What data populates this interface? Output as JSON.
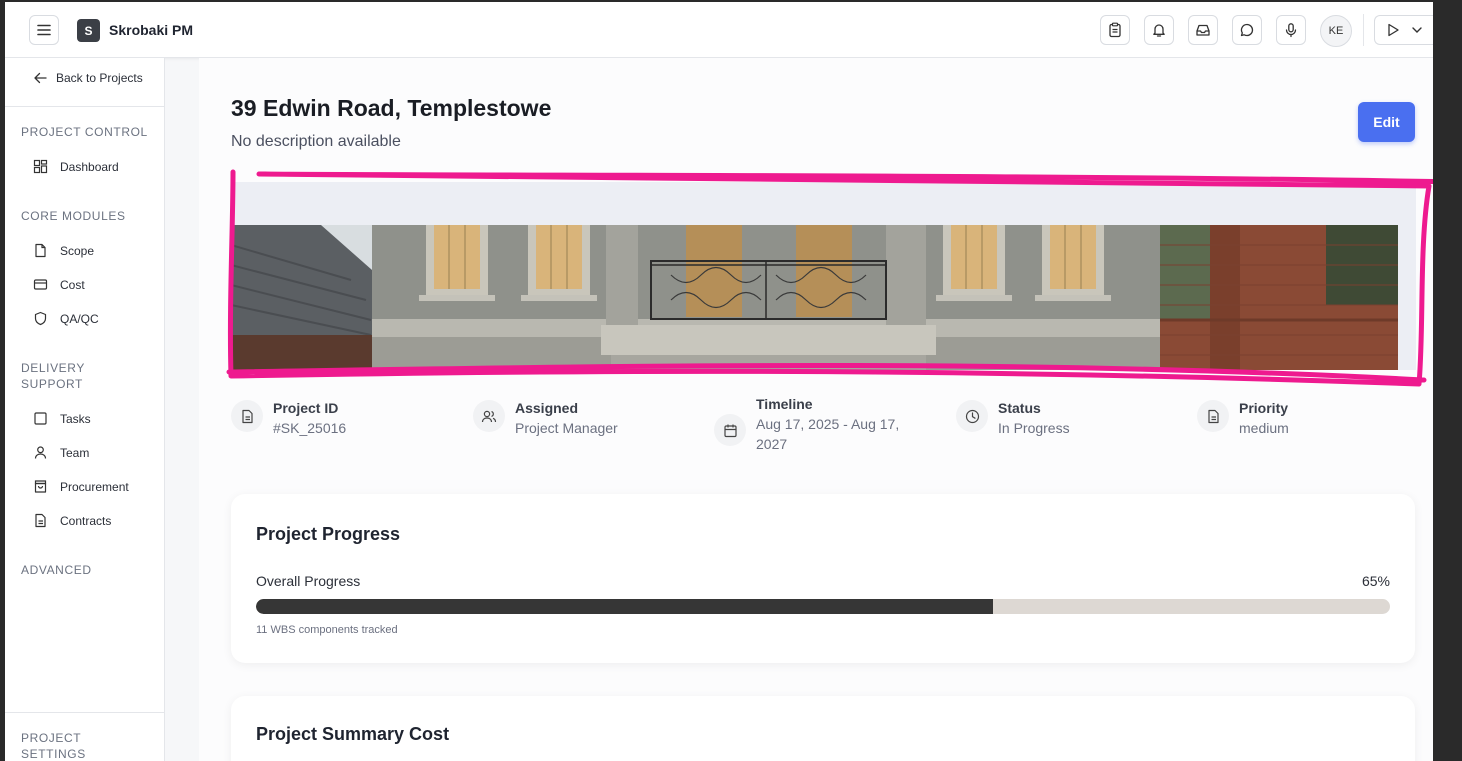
{
  "header": {
    "logo_letter": "S",
    "app_title": "Skrobaki PM",
    "avatar_initials": "KE",
    "icons": [
      "menu-icon",
      "clipboard-icon",
      "bell-icon",
      "inbox-icon",
      "chat-icon",
      "microphone-icon",
      "play-icon",
      "chevron-down-icon"
    ]
  },
  "sidebar": {
    "back_label": "Back to Projects",
    "sections": {
      "project_control": "PROJECT CONTROL",
      "core_modules": "CORE MODULES",
      "delivery_support": "DELIVERY SUPPORT",
      "advanced": "ADVANCED",
      "project_settings": "PROJECT SETTINGS"
    },
    "items": {
      "dashboard": "Dashboard",
      "scope": "Scope",
      "cost": "Cost",
      "qaqc": "QA/QC",
      "tasks": "Tasks",
      "team": "Team",
      "procurement": "Procurement",
      "contracts": "Contracts"
    }
  },
  "project": {
    "title": "39 Edwin Road, Templestowe",
    "description": "No description available",
    "edit_label": "Edit"
  },
  "meta": {
    "project_id": {
      "label": "Project ID",
      "value": "#SK_25016"
    },
    "assigned": {
      "label": "Assigned",
      "value": "Project Manager"
    },
    "timeline": {
      "label": "Timeline",
      "value": "Aug 17, 2025 - Aug 17, 2027"
    },
    "status": {
      "label": "Status",
      "value": "In Progress"
    },
    "priority": {
      "label": "Priority",
      "value": "medium"
    }
  },
  "progress": {
    "title": "Project Progress",
    "label": "Overall Progress",
    "percent_text": "65%",
    "fraction": 0.65,
    "note": "11 WBS components tracked"
  },
  "summary_cost": {
    "title": "Project Summary Cost"
  },
  "colors": {
    "accent": "#4a6ff0",
    "progress_fill": "#363636",
    "progress_track": "#ddd8d3",
    "highlight": "#ee1a8f"
  }
}
